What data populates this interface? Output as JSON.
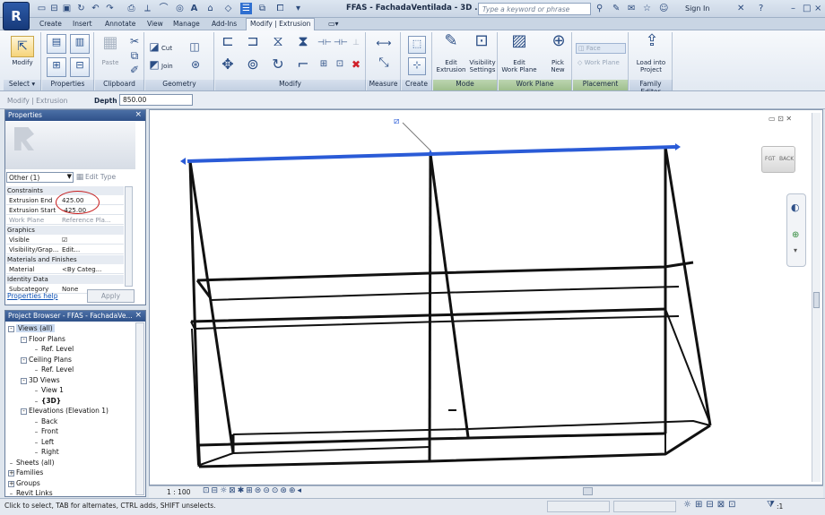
{
  "app": {
    "logo": "R",
    "title": "FFAS - FachadaVentilada - 3D ...",
    "search_placeholder": "Type a keyword or phrase",
    "signin": "Sign In"
  },
  "tabs": [
    "Create",
    "Insert",
    "Annotate",
    "View",
    "Manage",
    "Add-Ins",
    "Modify | Extrusion"
  ],
  "ribbon": {
    "panels": [
      "Select ▾",
      "Properties",
      "Clipboard",
      "Geometry",
      "Modify",
      "Measure",
      "Create",
      "Mode",
      "Work Plane",
      "Placement",
      "Family Editor"
    ],
    "buttons": {
      "modify": "Modify",
      "paste": "Paste",
      "cut": "Cut",
      "join": "Join",
      "edit_extrusion_1": "Edit",
      "edit_extrusion_2": "Extrusion",
      "visibility_1": "Visibility",
      "visibility_2": "Settings",
      "edit_wp_1": "Edit",
      "edit_wp_2": "Work Plane",
      "pick_new_1": "Pick",
      "pick_new_2": "New",
      "face": "Face",
      "work_plane": "Work Plane",
      "load_1": "Load into",
      "load_2": "Project"
    }
  },
  "options_bar": {
    "mode": "Modify | Extrusion",
    "depth_label": "Depth",
    "depth_value": "850.00"
  },
  "properties": {
    "title": "Properties",
    "type_selector": "Other (1)",
    "edit_type": "Edit Type",
    "rows": [
      {
        "kind": "section",
        "label": "Constraints"
      },
      {
        "kind": "row",
        "key": "Extrusion End",
        "value": "425.00"
      },
      {
        "kind": "row",
        "key": "Extrusion Start",
        "value": "-425.00"
      },
      {
        "kind": "row",
        "key": "Work Plane",
        "value": "Reference Pla..."
      },
      {
        "kind": "section",
        "label": "Graphics"
      },
      {
        "kind": "row",
        "key": "Visible",
        "value": "☑"
      },
      {
        "kind": "row",
        "key": "Visibility/Grap...",
        "value": "Edit..."
      },
      {
        "kind": "section",
        "label": "Materials and Finishes"
      },
      {
        "kind": "row",
        "key": "Material",
        "value": "<By Categ..."
      },
      {
        "kind": "section",
        "label": "Identity Data"
      },
      {
        "kind": "row",
        "key": "Subcategory",
        "value": "None"
      }
    ],
    "help": "Properties help",
    "apply": "Apply"
  },
  "browser": {
    "title": "Project Browser - FFAS - FachadaVe...",
    "nodes": [
      {
        "indent": 0,
        "tog": "-",
        "label": "Views (all)"
      },
      {
        "indent": 1,
        "tog": "-",
        "label": "Floor Plans"
      },
      {
        "indent": 2,
        "tog": "",
        "label": "Ref. Level"
      },
      {
        "indent": 1,
        "tog": "-",
        "label": "Ceiling Plans"
      },
      {
        "indent": 2,
        "tog": "",
        "label": "Ref. Level"
      },
      {
        "indent": 1,
        "tog": "-",
        "label": "3D Views"
      },
      {
        "indent": 2,
        "tog": "",
        "label": "View 1"
      },
      {
        "indent": 2,
        "tog": "",
        "label": "{3D}"
      },
      {
        "indent": 1,
        "tog": "-",
        "label": "Elevations (Elevation 1)"
      },
      {
        "indent": 2,
        "tog": "",
        "label": "Back"
      },
      {
        "indent": 2,
        "tog": "",
        "label": "Front"
      },
      {
        "indent": 2,
        "tog": "",
        "label": "Left"
      },
      {
        "indent": 2,
        "tog": "",
        "label": "Right"
      },
      {
        "indent": 0,
        "tog": "",
        "label": "Sheets (all)"
      },
      {
        "indent": 0,
        "tog": "+",
        "label": "Families"
      },
      {
        "indent": 0,
        "tog": "+",
        "label": "Groups"
      },
      {
        "indent": 0,
        "tog": "",
        "label": "Revit Links"
      }
    ]
  },
  "viewcube": {
    "left": "FGT",
    "right": "BACK"
  },
  "view_scale": "1 : 100",
  "status": "Click to select, TAB for alternates, CTRL adds, SHIFT unselects.",
  "status_right": ":1",
  "colors": {
    "accent": "#2f5189",
    "selection": "#2a5bd7",
    "highlight_circle": "#c71c1c"
  }
}
